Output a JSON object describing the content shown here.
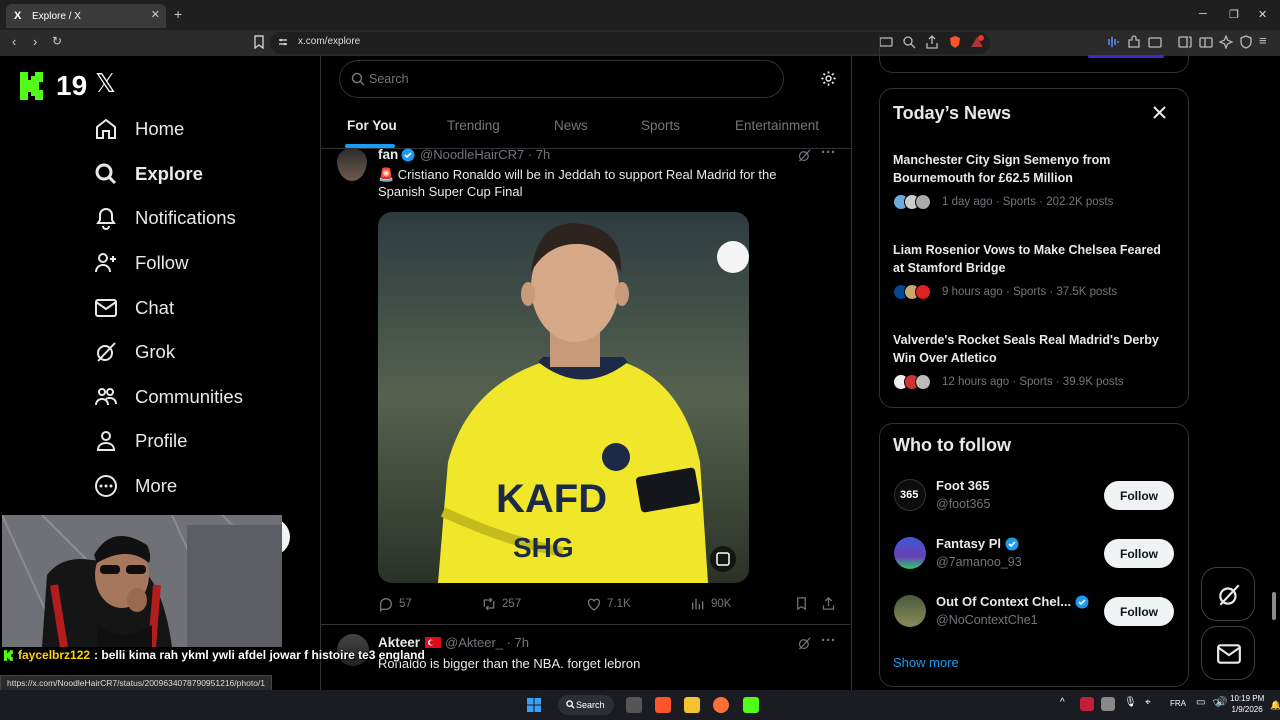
{
  "browser": {
    "tab_title": "Explore / X",
    "url": "x.com/explore",
    "status_url": "https://x.com/NoodleHairCR7/status/2009634078790951216/photo/1"
  },
  "branding": {
    "logo_number": "19",
    "logo_x": "𝕏"
  },
  "nav": [
    {
      "label": "Home",
      "icon": "home-icon"
    },
    {
      "label": "Explore",
      "icon": "search-icon"
    },
    {
      "label": "Notifications",
      "icon": "bell-icon"
    },
    {
      "label": "Follow",
      "icon": "follow-icon"
    },
    {
      "label": "Chat",
      "icon": "mail-icon"
    },
    {
      "label": "Grok",
      "icon": "grok-icon"
    },
    {
      "label": "Communities",
      "icon": "communities-icon"
    },
    {
      "label": "Profile",
      "icon": "profile-icon"
    },
    {
      "label": "More",
      "icon": "more-icon"
    }
  ],
  "search": {
    "placeholder": "Search"
  },
  "tabs": [
    "For You",
    "Trending",
    "News",
    "Sports",
    "Entertainment"
  ],
  "tweets": [
    {
      "name": "fan",
      "handle": "@NoodleHairCR7 · 7h",
      "text": "🚨 Cristiano Ronaldo will be in Jeddah to support Real Madrid for the Spanish Super Cup Final",
      "replies": "57",
      "reposts": "257",
      "likes": "7.1K",
      "views": "90K"
    },
    {
      "name": "Akteer",
      "handle": "@Akteer_ · 7h",
      "text": "Ronaldo is bigger than the NBA. forget lebron"
    }
  ],
  "news": {
    "title": "Today’s News",
    "items": [
      {
        "headline": "Manchester City Sign Semenyo from Bournemouth for £62.5 Million",
        "meta": "1 day ago · Sports · 202.2K posts"
      },
      {
        "headline": "Liam Rosenior Vows to Make Chelsea Feared at Stamford Bridge",
        "meta": "9 hours ago · Sports · 37.5K posts"
      },
      {
        "headline": "Valverde's Rocket Seals Real Madrid's Derby Win Over Atletico",
        "meta": "12 hours ago · Sports · 39.9K posts"
      }
    ]
  },
  "who_to_follow": {
    "title": "Who to follow",
    "button_label": "Follow",
    "show_more": "Show more",
    "accounts": [
      {
        "name": "Foot 365",
        "handle": "@foot365",
        "verified": false
      },
      {
        "name": "Fantasy Pl",
        "handle": "@7amanoo_93",
        "verified": true
      },
      {
        "name": "Out Of Context Chel...",
        "handle": "@NoContextChe1",
        "verified": true
      }
    ]
  },
  "stream_chat": {
    "user": "faycelbrz122",
    "message": ": belli kima rah ykml ywli afdel jowar f histoire te3 england"
  },
  "taskbar": {
    "search_label": "Search",
    "lang": "FRA",
    "time": "10:19 PM",
    "date": "1/9/2026"
  },
  "colors": {
    "accent": "#1d9bf0",
    "kick_green": "#53fc18",
    "background": "#000000"
  }
}
